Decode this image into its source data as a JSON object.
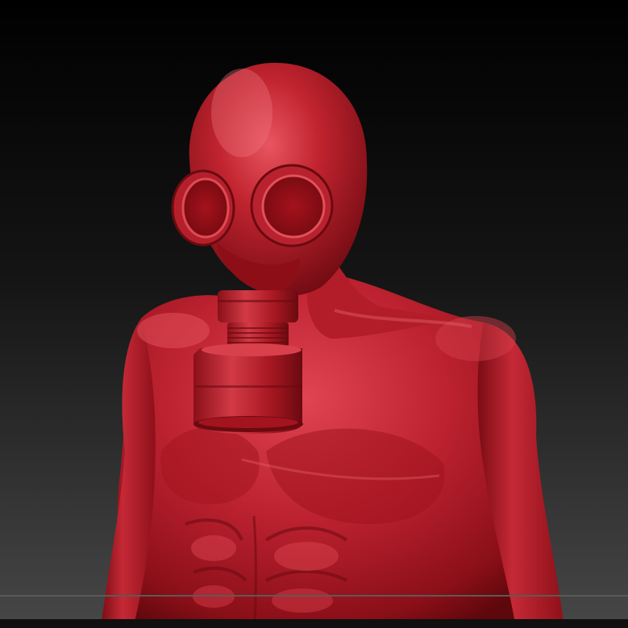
{
  "scene": {
    "subject": "sculpted-figure-with-gas-mask",
    "colors": {
      "background_top": "#000000",
      "background_bottom": "#474747",
      "material_base": "#b71c25",
      "material_highlight": "#e54a55",
      "material_shadow": "#5e070c",
      "floor_line": "#5a5a5a"
    }
  }
}
